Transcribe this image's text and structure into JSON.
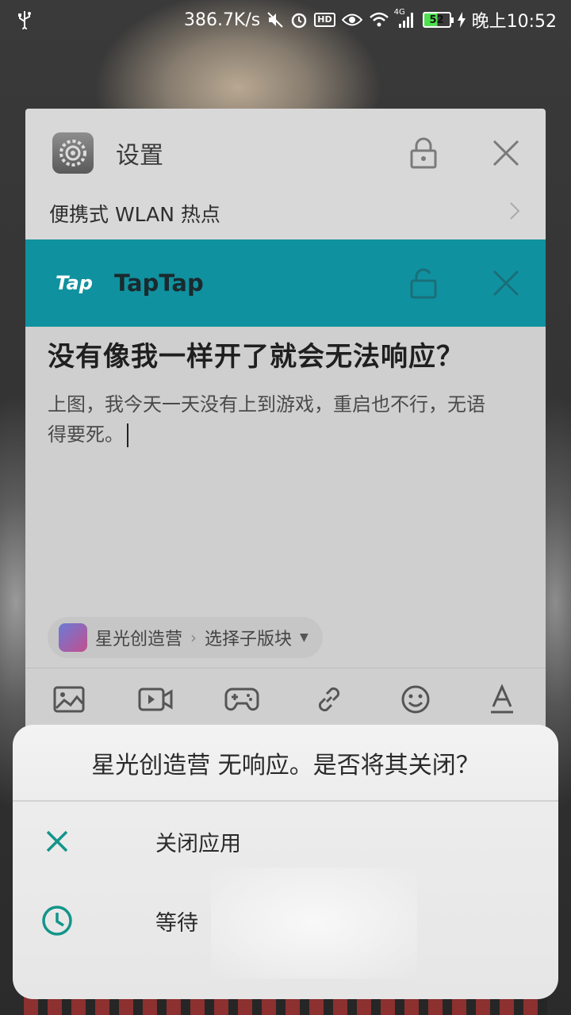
{
  "status_bar": {
    "network_speed": "386.7K/s",
    "hd_label": "HD",
    "signal_type": "4G",
    "battery_level": "52",
    "time": "晚上10:52"
  },
  "recent_settings": {
    "title": "设置",
    "subtitle": "便携式 WLAN 热点"
  },
  "recent_taptap": {
    "logo": "Tap",
    "title": "TapTap",
    "post_title": "没有像我一样开了就会无法响应？",
    "post_body_line1": "上图，我今天一天没有上到游戏，重启也不行，无语",
    "post_body_line2": "得要死。",
    "forum_name": "星光创造营",
    "subforum_label": "选择子版块"
  },
  "dialog": {
    "message": "星光创造营 无响应。是否将其关闭？",
    "options": [
      {
        "label": "关闭应用",
        "icon": "close-icon"
      },
      {
        "label": "等待",
        "icon": "clock-icon"
      }
    ],
    "accent_color": "#12958a"
  },
  "colors": {
    "taptap_header": "#10919f"
  }
}
